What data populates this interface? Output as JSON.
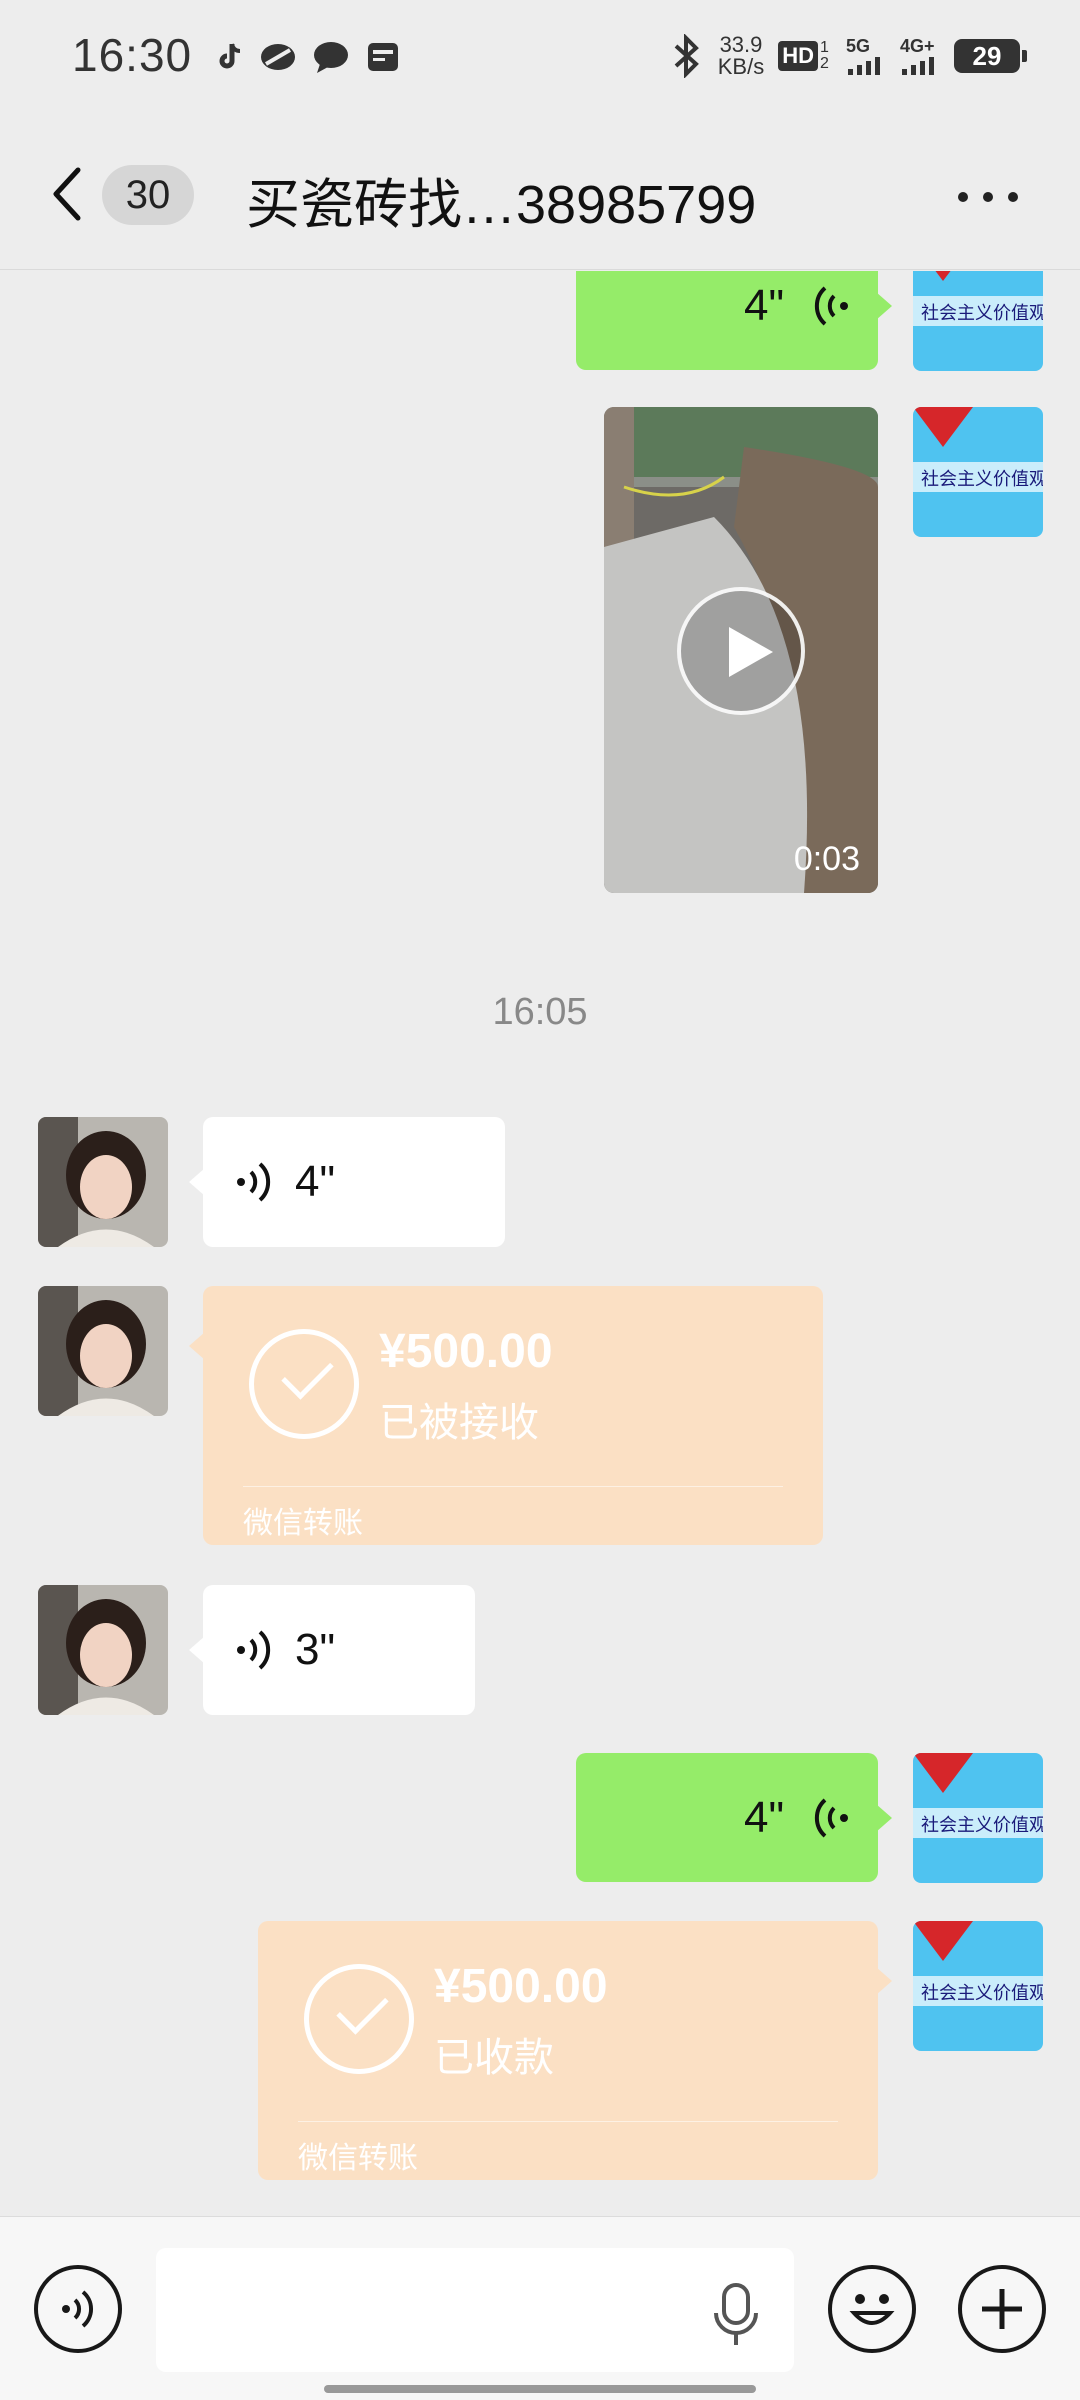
{
  "status_bar": {
    "time": "16:30",
    "net_speed_value": "33.9",
    "net_speed_unit": "KB/s",
    "hd_label": "HD",
    "hd_sub": "1 2",
    "signal_5g": "5G",
    "signal_4g": "4G+",
    "battery": "29"
  },
  "nav": {
    "unread_count": "30",
    "title": "买瓷砖找…38985799"
  },
  "messages": {
    "m1_duration": "4\"",
    "video_duration": "0:03",
    "timestamp": "16:05",
    "m3_duration": "4\"",
    "m4_amount": "¥500.00",
    "m4_status": "已被接收",
    "m4_label": "微信转账",
    "m5_duration": "3\"",
    "m6_duration": "4\"",
    "m7_amount": "¥500.00",
    "m7_status": "已收款",
    "m7_label": "微信转账"
  },
  "avatars": {
    "self_avatar_text": "社会主义核心价值观"
  },
  "input_bar": {
    "placeholder": ""
  },
  "colors": {
    "background": "#ededed",
    "sent_bubble": "#95ec69",
    "received_bubble": "#ffffff",
    "transfer_card": "#fbe0c4"
  }
}
